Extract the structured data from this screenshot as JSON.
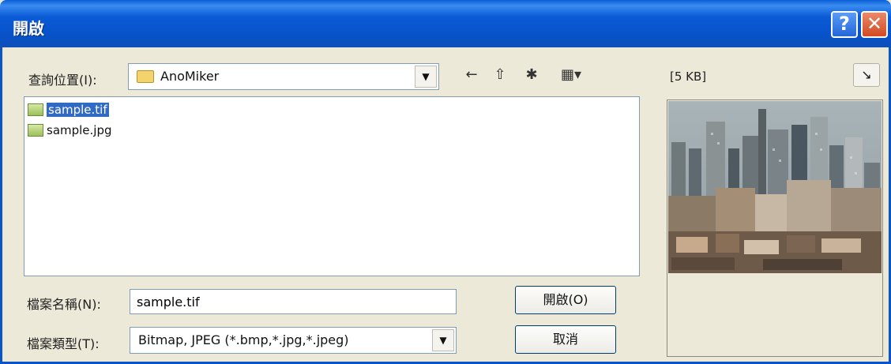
{
  "dialog": {
    "title": "開啟"
  },
  "titlebar": {
    "help": "?",
    "close": "✕"
  },
  "lookin": {
    "label": "查詢位置(I):",
    "value": "AnoMiker"
  },
  "toolbar": {
    "back": "←",
    "up": "⇧",
    "newfolder": "✱",
    "view": "▦▾"
  },
  "files": [
    {
      "name": "sample.tif",
      "selected": true
    },
    {
      "name": "sample.jpg",
      "selected": false
    }
  ],
  "preview": {
    "label": "[5 KB]",
    "button": "↘"
  },
  "filename": {
    "label": "檔案名稱(N):",
    "value": "sample.tif"
  },
  "filetype": {
    "label": "檔案類型(T):",
    "value": "Bitmap, JPEG (*.bmp,*.jpg,*.jpeg)"
  },
  "buttons": {
    "open": "開啟(O)",
    "cancel": "取消"
  }
}
